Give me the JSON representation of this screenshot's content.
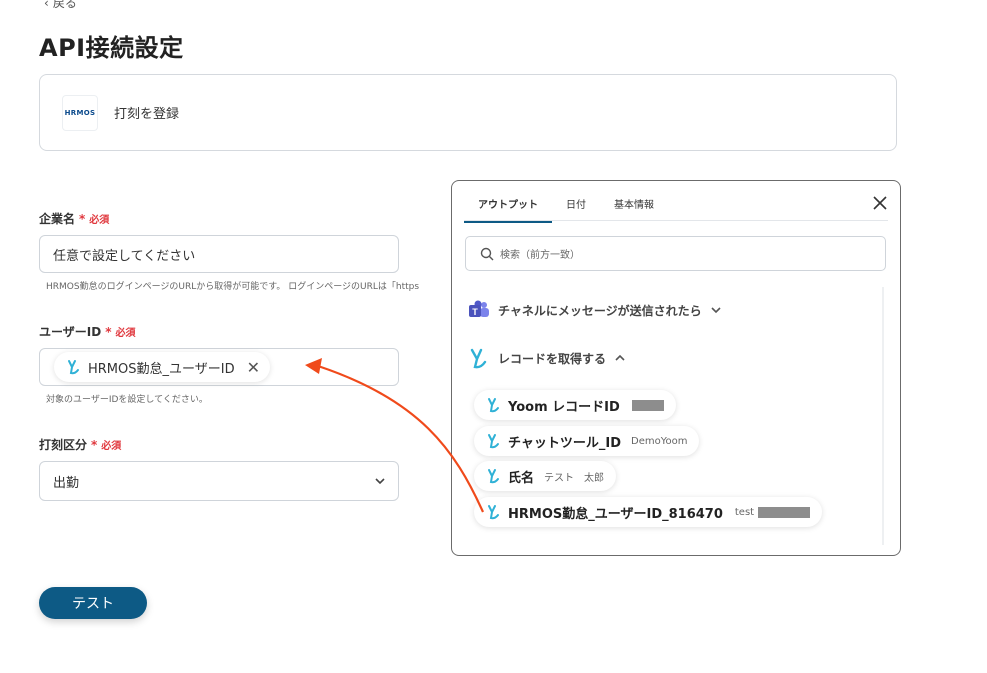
{
  "nav": {
    "back_label": "戻る"
  },
  "page": {
    "title": "API接続設定"
  },
  "app": {
    "logo_text": "HRMOS",
    "action_label": "打刻を登録"
  },
  "form": {
    "required_label": "必須",
    "company": {
      "label": "企業名",
      "placeholder": "任意で設定してください",
      "hint": "HRMOS勤怠のログインページのURLから取得が可能です。 ログインページのURLは「https"
    },
    "user_id": {
      "label": "ユーザーID",
      "chip_label": "HRMOS勤怠_ユーザーID",
      "hint": "対象のユーザーIDを設定してください。"
    },
    "punch_type": {
      "label": "打刻区分",
      "value": "出勤"
    },
    "test_button": "テスト"
  },
  "output_panel": {
    "tabs": [
      "アウトプット",
      "日付",
      "基本情報"
    ],
    "search_placeholder": "検索（前方一致）",
    "groups": [
      {
        "label": "チャネルにメッセージが送信されたら",
        "expanded": false,
        "icon": "teams-icon"
      },
      {
        "label": "レコードを取得する",
        "expanded": true,
        "icon": "yoom-icon"
      }
    ],
    "items": [
      {
        "label": "Yoom レコードID",
        "value": ""
      },
      {
        "label": "チャットツール_ID",
        "value": "DemoYoom"
      },
      {
        "label": "氏名",
        "value": "テスト　太郎"
      },
      {
        "label": "HRMOS勤怠_ユーザーID_816470",
        "value": "test"
      }
    ]
  },
  "colors": {
    "accent": "#0d5a85",
    "required": "#e0383e",
    "arrow": "#f04a1b",
    "yoom_icon": "#2fb1d6"
  }
}
